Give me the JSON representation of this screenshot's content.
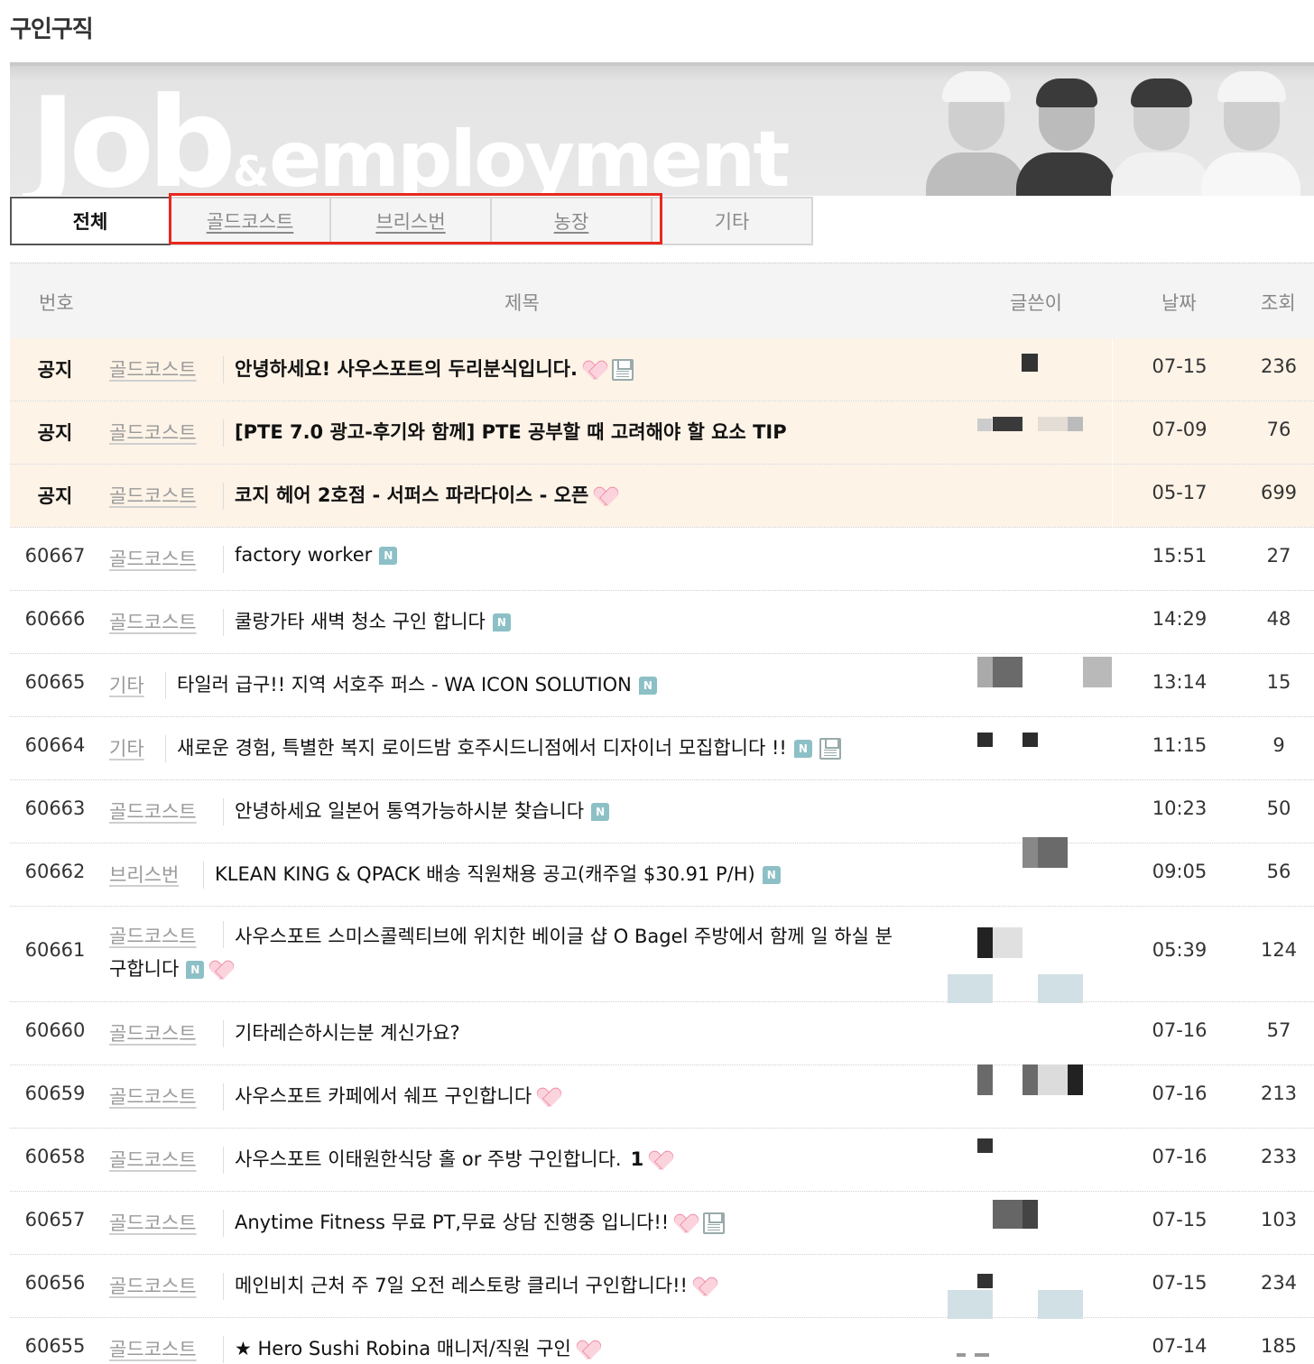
{
  "page": {
    "title": "구인구직"
  },
  "banner": {
    "word_big": "Job",
    "word_amp": "&",
    "word_small": "employment"
  },
  "tabs": [
    {
      "label": "전체",
      "active": true
    },
    {
      "label": "골드코스트",
      "active": false
    },
    {
      "label": "브리스번",
      "active": false
    },
    {
      "label": "농장",
      "active": false
    },
    {
      "label": "기타",
      "active": false
    }
  ],
  "table": {
    "headers": {
      "no": "번호",
      "subject": "제목",
      "writer": "글쓴이",
      "date": "날짜",
      "views": "조회"
    },
    "rows": [
      {
        "no": "공지",
        "category": "골드코스트",
        "title": "안녕하세요! 사우스포트의 두리분식입니다.",
        "icons": [
          "heart-icon",
          "disk-icon"
        ],
        "date": "07-15",
        "views": "236"
      },
      {
        "no": "공지",
        "category": "골드코스트",
        "title": "[PTE 7.0 광고-후기와 함께] PTE 공부할 때 고려해야 할 요소 TIP",
        "icons": [],
        "date": "07-09",
        "views": "76"
      },
      {
        "no": "공지",
        "category": "골드코스트",
        "title": "코지 헤어 2호점 - 서퍼스 파라다이스 - 오픈",
        "icons": [
          "heart-icon"
        ],
        "date": "05-17",
        "views": "699"
      },
      {
        "no": "60667",
        "category": "골드코스트",
        "title": "factory worker",
        "icons": [
          "new-icon"
        ],
        "date": "15:51",
        "views": "27"
      },
      {
        "no": "60666",
        "category": "골드코스트",
        "title": "쿨랑가타 새벽 청소 구인 합니다",
        "icons": [
          "new-icon"
        ],
        "date": "14:29",
        "views": "48"
      },
      {
        "no": "60665",
        "category": "기타",
        "title": "타일러 급구!! 지역 서호주 퍼스 - WA ICON SOLUTION",
        "icons": [
          "new-icon"
        ],
        "date": "13:14",
        "views": "15"
      },
      {
        "no": "60664",
        "category": "기타",
        "title": "새로운 경험, 특별한 복지 로이드밤 호주시드니점에서 디자이너 모집합니다 !!",
        "icons": [
          "new-icon",
          "disk-icon"
        ],
        "date": "11:15",
        "views": "9"
      },
      {
        "no": "60663",
        "category": "골드코스트",
        "title": "안녕하세요 일본어 통역가능하시분 찾습니다",
        "icons": [
          "new-icon"
        ],
        "date": "10:23",
        "views": "50"
      },
      {
        "no": "60662",
        "category": "브리스번",
        "title": "KLEAN KING & QPACK 배송 직원채용 공고(캐주얼 $30.91 P/H)",
        "icons": [
          "new-icon"
        ],
        "date": "09:05",
        "views": "56"
      },
      {
        "no": "60661",
        "category": "골드코스트",
        "title": "사우스포트 스미스콜렉티브에 위치한 베이글 샵 O Bagel 주방에서 함께 일 하실 분",
        "title2": "구합니다",
        "icons": [
          "new-icon",
          "heart-icon"
        ],
        "date": "05:39",
        "views": "124"
      },
      {
        "no": "60660",
        "category": "골드코스트",
        "title": "기타레슨하시는분 계신가요?",
        "icons": [],
        "date": "07-16",
        "views": "57"
      },
      {
        "no": "60659",
        "category": "골드코스트",
        "title": "사우스포트 카페에서 쉐프 구인합니다",
        "icons": [
          "heart-icon"
        ],
        "date": "07-16",
        "views": "213"
      },
      {
        "no": "60658",
        "category": "골드코스트",
        "title": "사우스포트 이태원한식당 홀 or 주방 구인합니다.",
        "comments": "1",
        "icons": [
          "heart-icon"
        ],
        "date": "07-16",
        "views": "233"
      },
      {
        "no": "60657",
        "category": "골드코스트",
        "title": "Anytime Fitness 무료 PT,무료 상담 진행중 입니다!!",
        "icons": [
          "heart-icon",
          "disk-icon"
        ],
        "date": "07-15",
        "views": "103"
      },
      {
        "no": "60656",
        "category": "골드코스트",
        "title": "메인비치 근처 주 7일 오전 레스토랑 클리너 구인합니다!!",
        "icons": [
          "heart-icon"
        ],
        "date": "07-15",
        "views": "234"
      },
      {
        "no": "60655",
        "category": "골드코스트",
        "title": "★ Hero Sushi Robina 매니저/직원 구인",
        "icons": [
          "heart-icon"
        ],
        "date": "07-14",
        "views": "185"
      }
    ]
  },
  "colors": {
    "notice_bg": "#fdf3e7",
    "highlight": "#e8281e",
    "new_badge": "#8cc0c6"
  }
}
